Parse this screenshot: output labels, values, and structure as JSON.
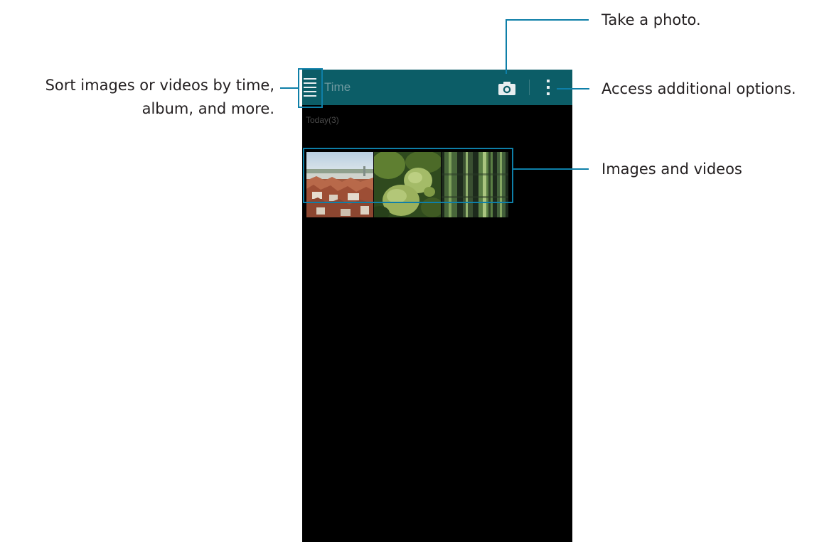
{
  "app": {
    "title": "Time",
    "section_header": "Today(3)",
    "thumbnails": [
      {
        "label": "city-rooftops-thumbnail"
      },
      {
        "label": "green-flowers-thumbnail"
      },
      {
        "label": "mossy-tree-trunks-thumbnail"
      }
    ]
  },
  "icons": {
    "menu": "hamburger-menu-icon",
    "camera": "camera-icon",
    "more": "overflow-menu-icon"
  },
  "callouts": {
    "sort": {
      "line1": "Sort images or videos by time,",
      "line2": "album, and more."
    },
    "camera": "Take a photo.",
    "more": "Access additional options.",
    "thumbs": "Images and videos"
  },
  "colors": {
    "action_bar": "#0c5d67",
    "callout": "#0e7fa8",
    "screen_background": "#000000"
  }
}
